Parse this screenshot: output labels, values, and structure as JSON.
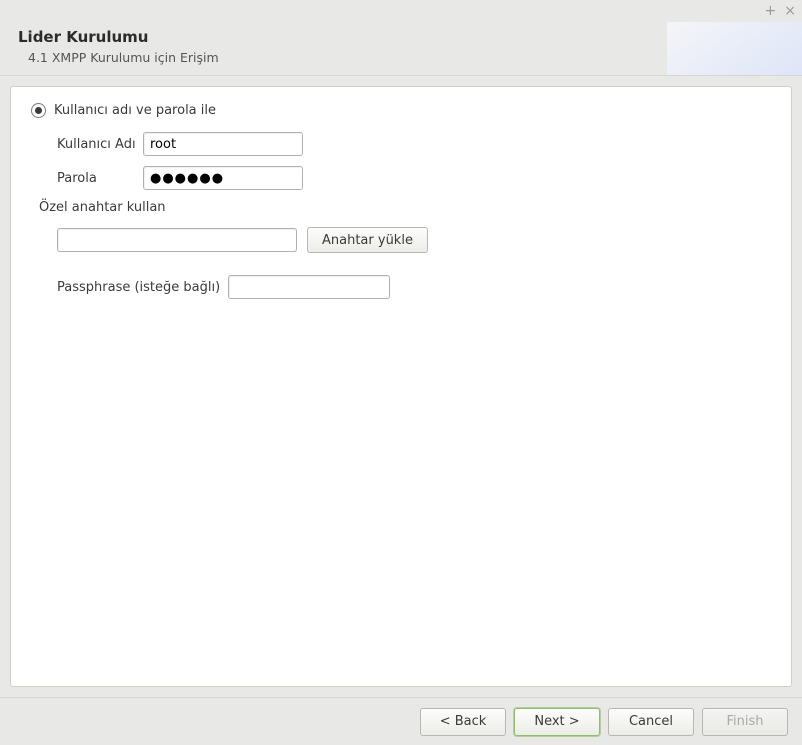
{
  "window": {
    "minimize_glyph": "+",
    "close_glyph": "×"
  },
  "header": {
    "title": "Lider Kurulumu",
    "subtitle": "4.1 XMPP Kurulumu için Erişim"
  },
  "form": {
    "auth_mode_label": "Kullanıcı adı ve parola ile",
    "username_label": "Kullanıcı Adı",
    "username_value": "root",
    "password_label": "Parola",
    "password_value": "●●●●●●",
    "private_key_label": "Özel anahtar kullan",
    "key_path_value": "",
    "load_key_button": "Anahtar yükle",
    "passphrase_label": "Passphrase (isteğe bağlı)",
    "passphrase_value": ""
  },
  "footer": {
    "back": "< Back",
    "next": "Next >",
    "cancel": "Cancel",
    "finish": "Finish"
  }
}
